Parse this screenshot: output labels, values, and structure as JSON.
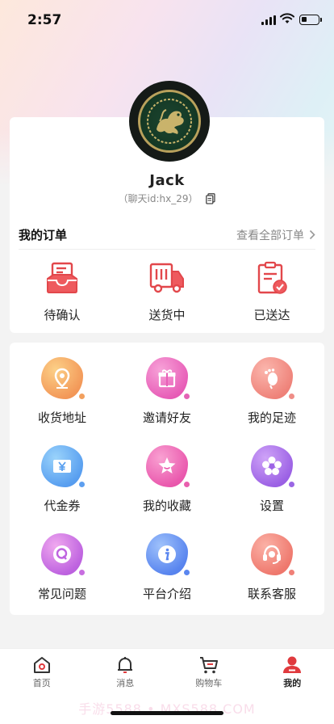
{
  "status_bar": {
    "time": "2:57",
    "battery_level": 0.3
  },
  "profile": {
    "username": "Jack",
    "chat_id": "（聊天id:hx_29）"
  },
  "orders": {
    "title": "我的订单",
    "view_all": "查看全部订单",
    "items": [
      {
        "label": "待确认",
        "icon": "inbox-icon"
      },
      {
        "label": "送货中",
        "icon": "delivery-truck-icon"
      },
      {
        "label": "已送达",
        "icon": "clipboard-check-icon"
      }
    ]
  },
  "services": {
    "items": [
      {
        "label": "收货地址",
        "icon": "location-pin-icon",
        "color": "#f6a766"
      },
      {
        "label": "邀请好友",
        "icon": "gift-icon",
        "color": "#ec6fbf"
      },
      {
        "label": "我的足迹",
        "icon": "footprint-icon",
        "color": "#f08f8a"
      },
      {
        "label": "代金券",
        "icon": "yen-coupon-icon",
        "color": "#5aa6f2"
      },
      {
        "label": "我的收藏",
        "icon": "star-icon",
        "color": "#ee63b3"
      },
      {
        "label": "设置",
        "icon": "settings-flower-icon",
        "color": "#a368e6"
      },
      {
        "label": "常见问题",
        "icon": "question-icon",
        "color": "#c86fe4"
      },
      {
        "label": "平台介绍",
        "icon": "info-icon",
        "color": "#5b8ff0"
      },
      {
        "label": "联系客服",
        "icon": "headset-icon",
        "color": "#f27c72"
      }
    ]
  },
  "tabbar": {
    "items": [
      {
        "label": "首页",
        "icon": "home-icon",
        "active": false
      },
      {
        "label": "消息",
        "icon": "bell-icon",
        "active": false
      },
      {
        "label": "购物车",
        "icon": "cart-icon",
        "active": false
      },
      {
        "label": "我的",
        "icon": "profile-icon",
        "active": true
      }
    ]
  },
  "watermark": "手游5588 • MXS588.COM",
  "colors": {
    "accent": "#e03a3e",
    "order_icon": "#e2474b"
  }
}
